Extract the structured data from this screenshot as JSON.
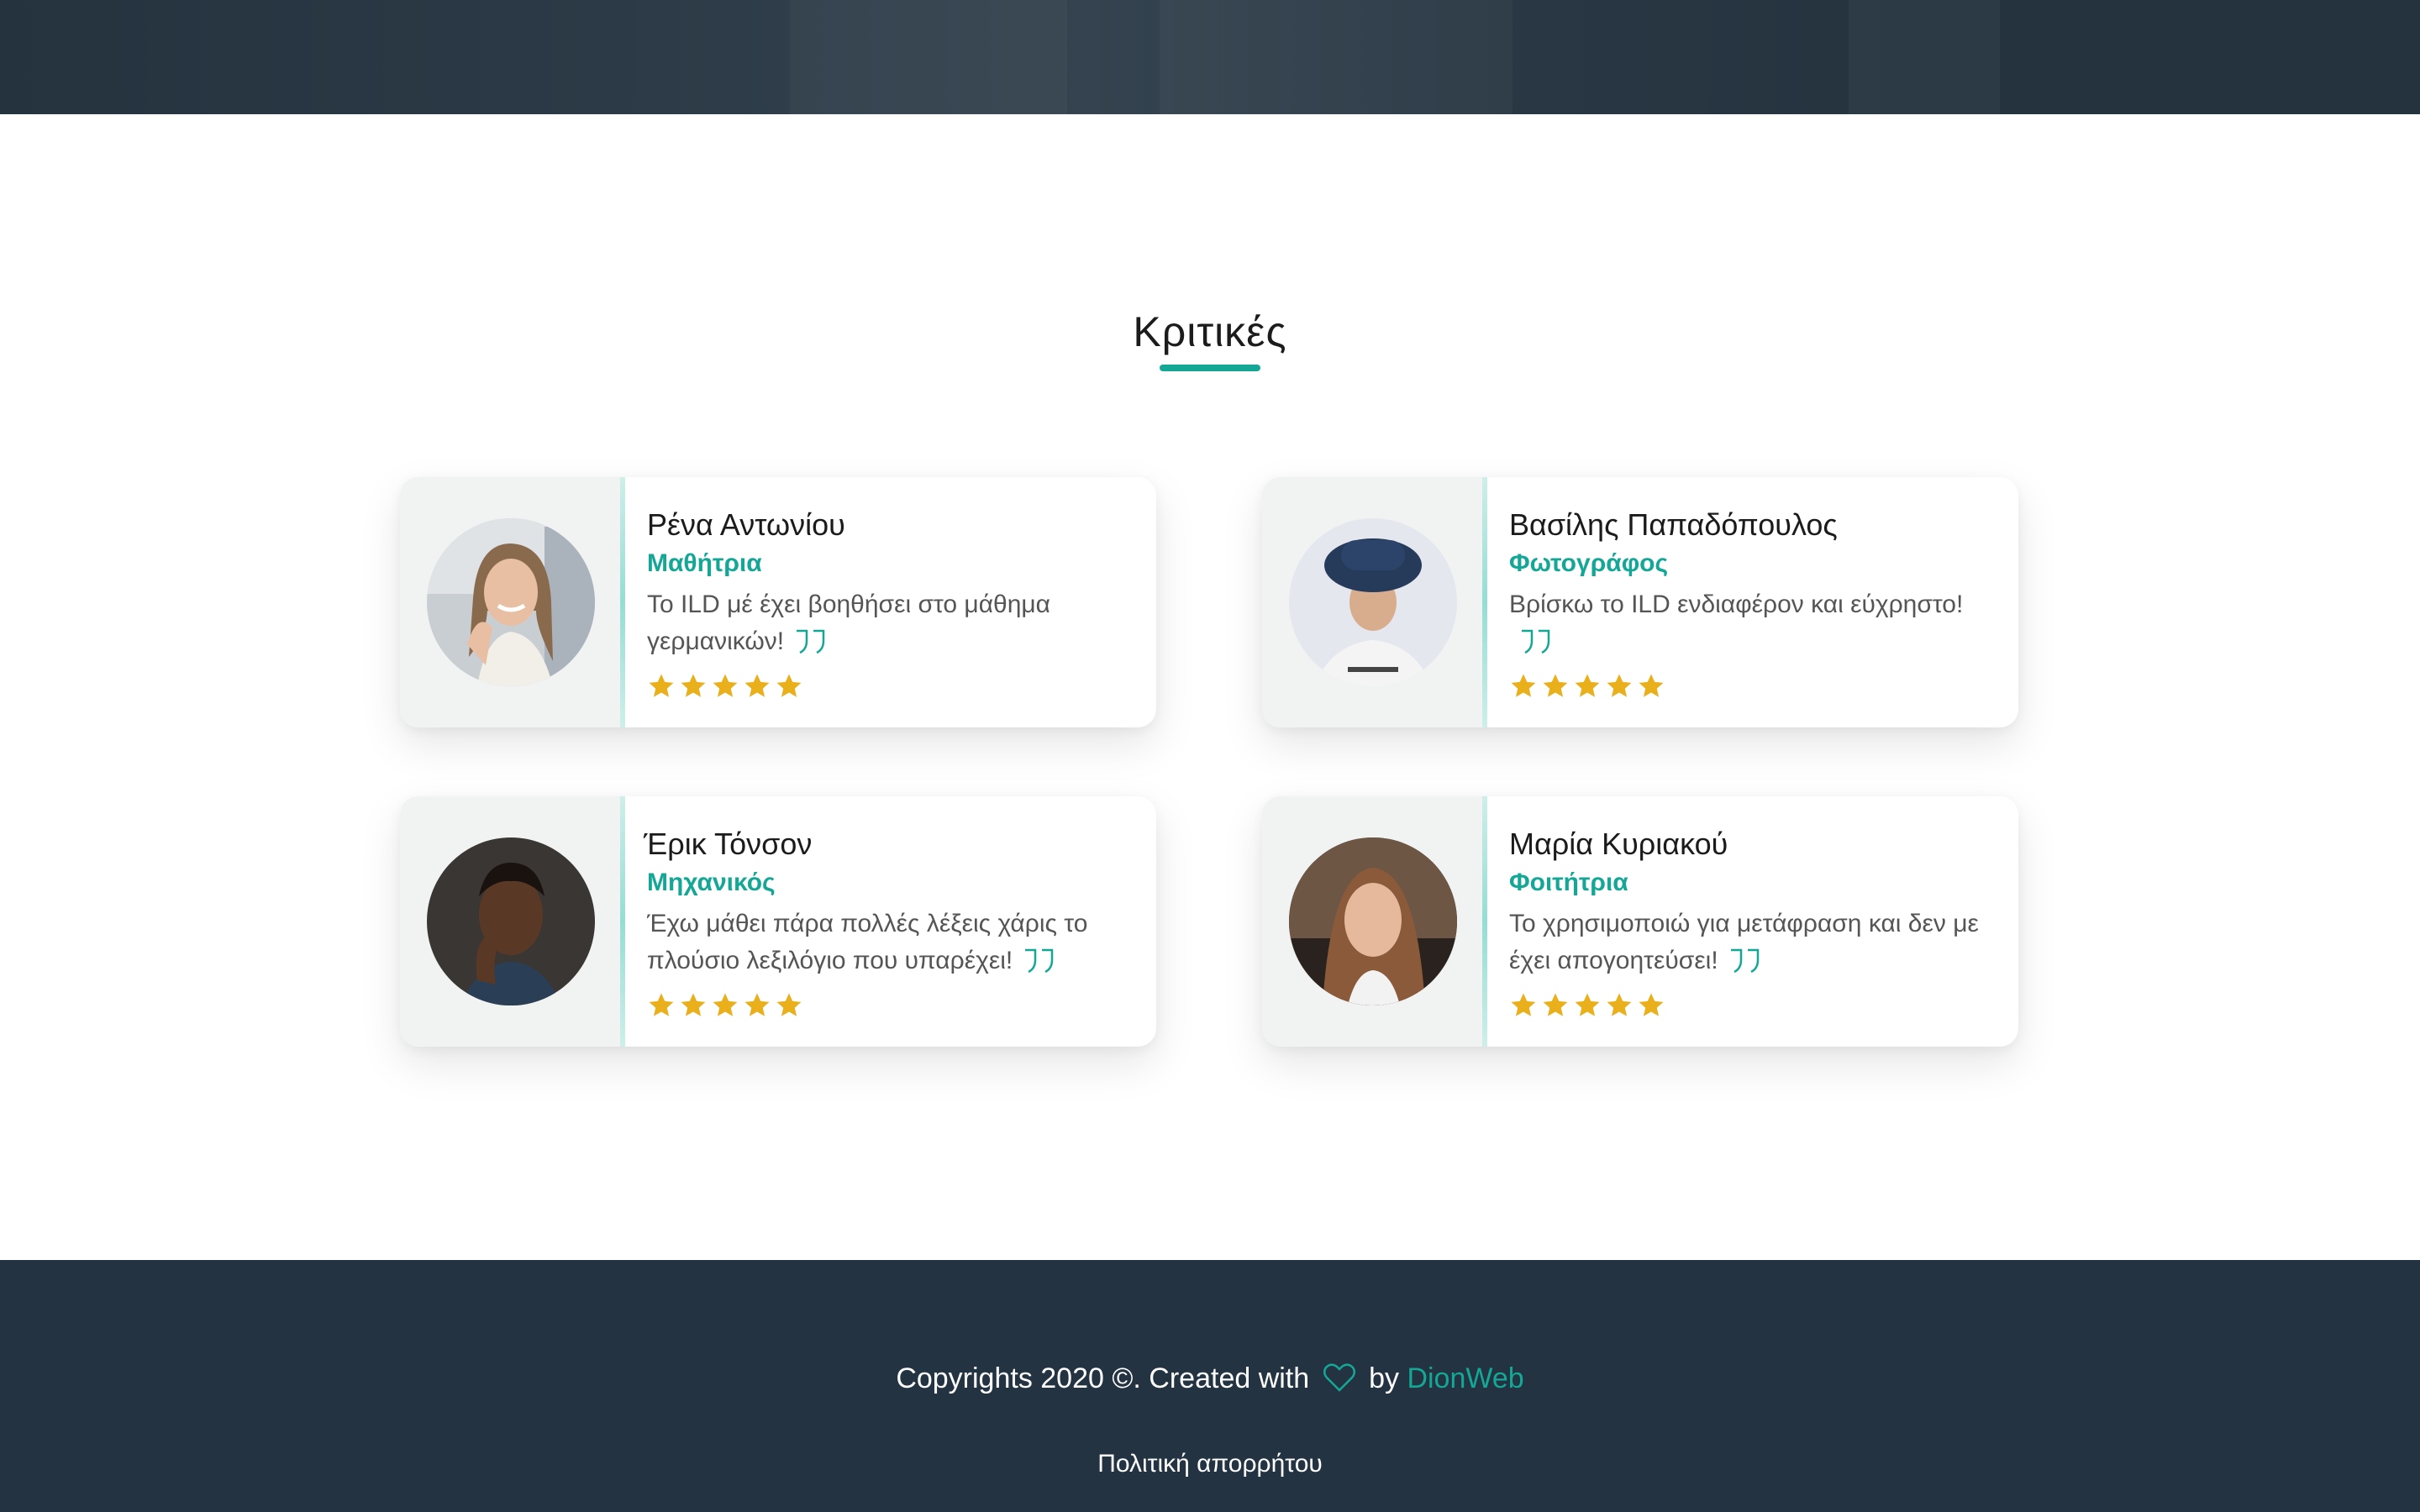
{
  "reviews": {
    "title": "Κριτικές",
    "items": [
      {
        "name": "Ρένα Αντωνίου",
        "role": "Μαθήτρια",
        "quote": "Το ILD μέ έχει βοηθήσει στο μάθημα γερμανικών!",
        "rating": 5
      },
      {
        "name": "Βασίλης Παπαδόπουλος",
        "role": "Φωτογράφος",
        "quote": "Βρίσκω το ILD ενδιαφέρον και εύχρηστο!",
        "rating": 5
      },
      {
        "name": "Έρικ Τόνσον",
        "role": "Μηχανικός",
        "quote": "Έχω μάθει πάρα πολλές λέξεις χάρις το πλούσιο λεξιλόγιο που υπαρέχει!",
        "rating": 5
      },
      {
        "name": "Μαρία Κυριακού",
        "role": "Φοιτήτρια",
        "quote": "Το χρησιμοποιώ για μετάφραση και δεν με έχει απογοητεύσει!",
        "rating": 5
      }
    ]
  },
  "footer": {
    "copyright_prefix": "Copyrights 2020 ©. Created with",
    "by": "by",
    "brand": "DionWeb",
    "privacy": "Πολιτική απορρήτου"
  },
  "colors": {
    "accent": "#14a796",
    "star": "#e9b01c",
    "footer_bg": "#233342"
  },
  "icons": {
    "quote": "quote-icon",
    "star": "star-icon",
    "heart": "heart-icon"
  }
}
